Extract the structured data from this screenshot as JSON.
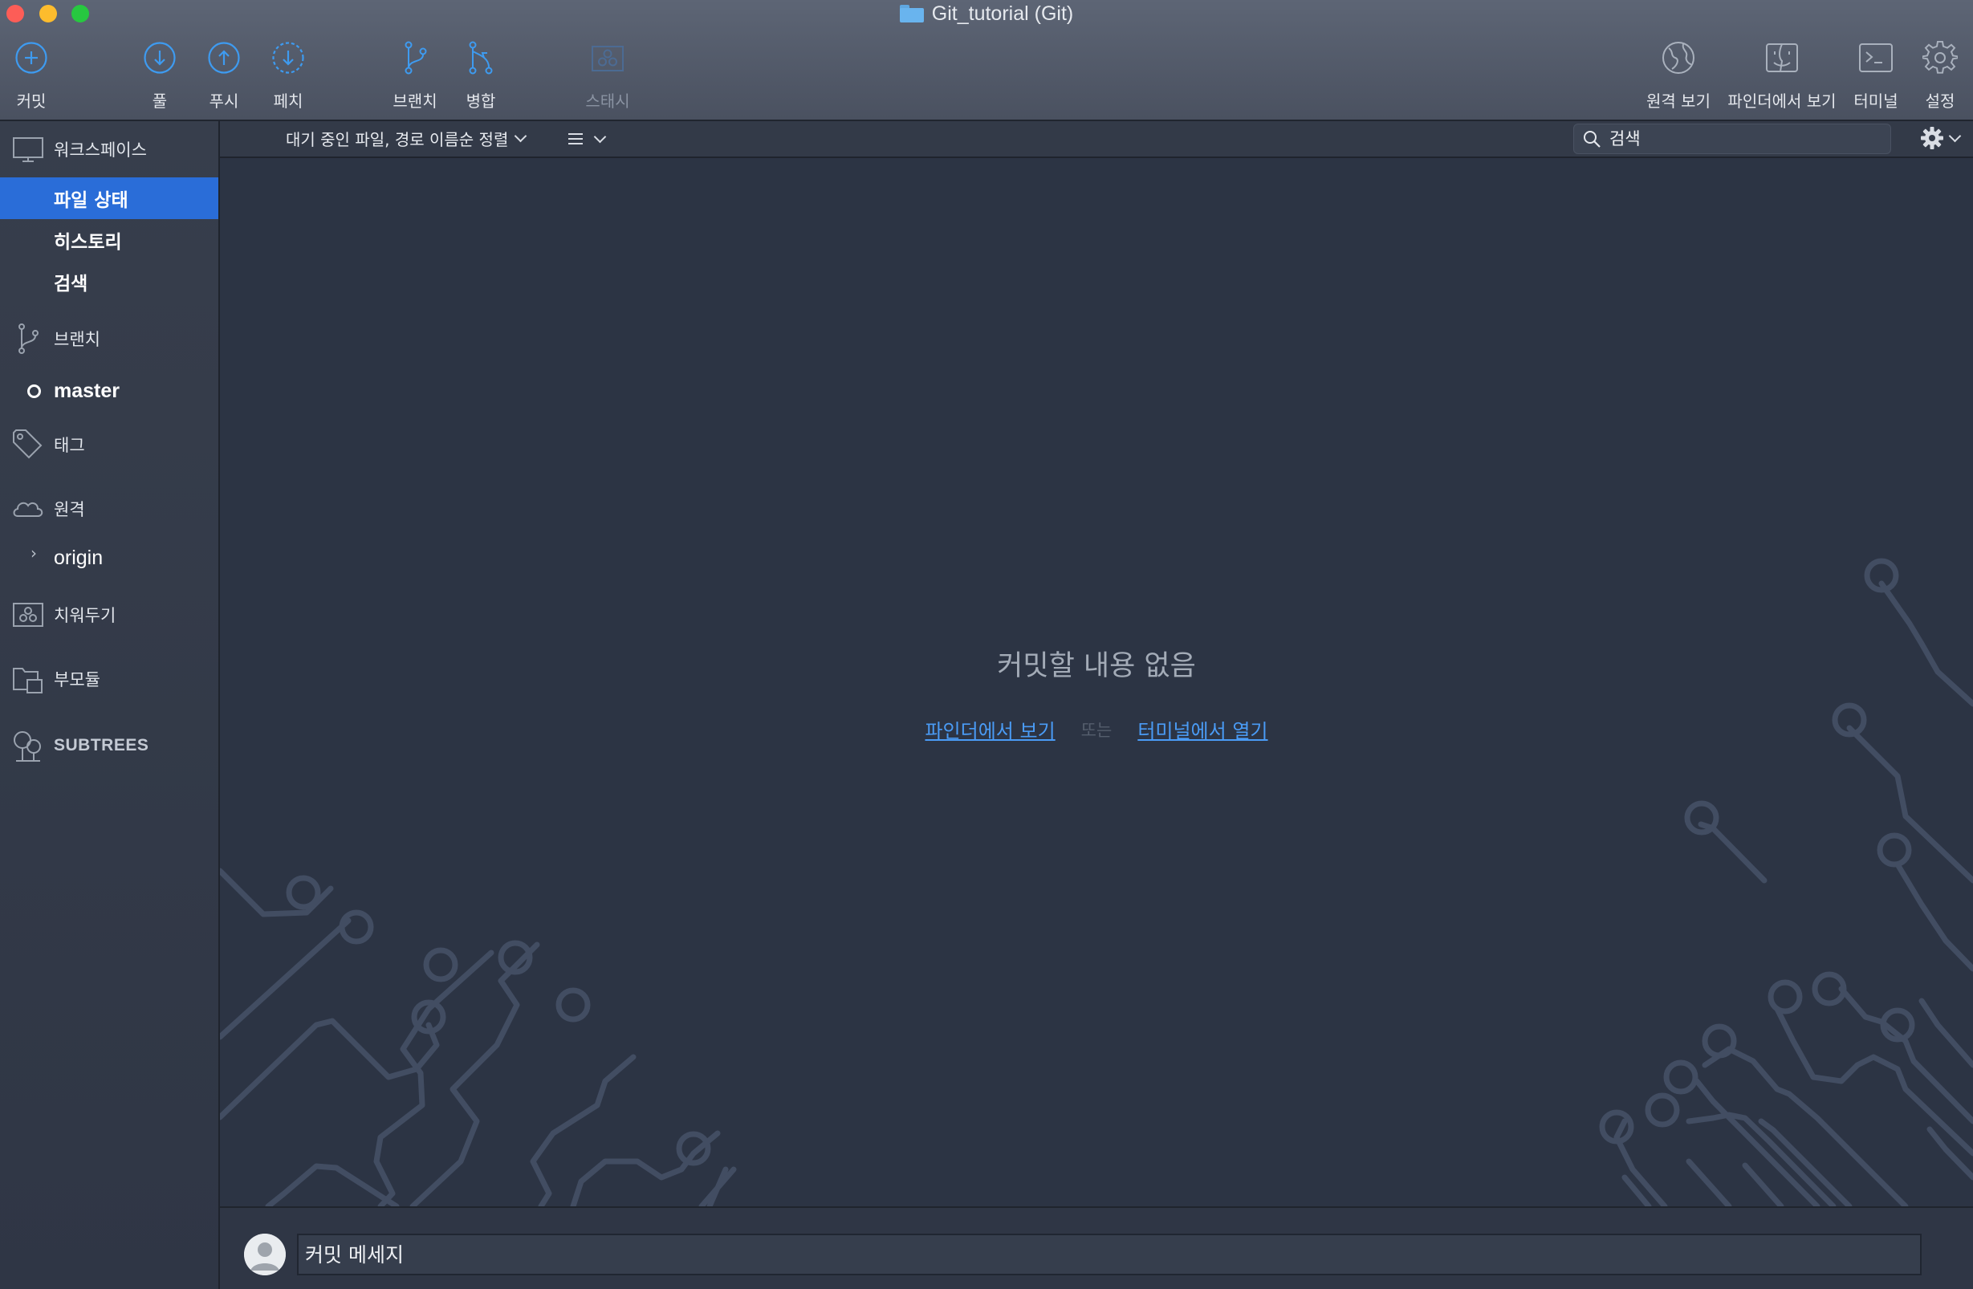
{
  "window": {
    "title": "Git_tutorial (Git)"
  },
  "toolbar": {
    "commit": "커밋",
    "pull": "풀",
    "push": "푸시",
    "fetch": "페치",
    "branch": "브랜치",
    "merge": "병합",
    "stash": "스태시",
    "remote_view": "원격 보기",
    "finder_view": "파인더에서 보기",
    "terminal": "터미널",
    "settings": "설정"
  },
  "sidebar": {
    "workspace": "워크스페이스",
    "file_status": "파일 상태",
    "history": "히스토리",
    "search": "검색",
    "branches": "브랜치",
    "current_branch": "master",
    "tags": "태그",
    "remotes": "원격",
    "remote_origin": "origin",
    "stashes": "치워두기",
    "submodules": "부모듈",
    "subtrees": "SUBTREES"
  },
  "header": {
    "sort_label": "대기 중인 파일, 경로 이름순 정렬",
    "search_value": "검색"
  },
  "main": {
    "empty_title": "커밋할 내용 없음",
    "link_finder": "파인더에서 보기",
    "separator": "또는",
    "link_terminal": "터미널에서 열기"
  },
  "commit": {
    "placeholder": "커밋 메세지"
  },
  "colors": {
    "accent": "#2a6dd8",
    "link": "#4a9bf5",
    "icon_blue": "#3e9bf0",
    "background": "#2c3444"
  },
  "icons": {
    "commit": "plus-circle-icon",
    "pull": "arrow-down-circle-icon",
    "push": "arrow-up-circle-icon",
    "fetch": "dashed-arrow-down-circle-icon",
    "branch": "branch-icon",
    "merge": "merge-icon",
    "stash": "stash-box-icon",
    "remote_view": "globe-icon",
    "finder_view": "finder-icon",
    "terminal": "terminal-icon",
    "settings": "gear-icon"
  }
}
